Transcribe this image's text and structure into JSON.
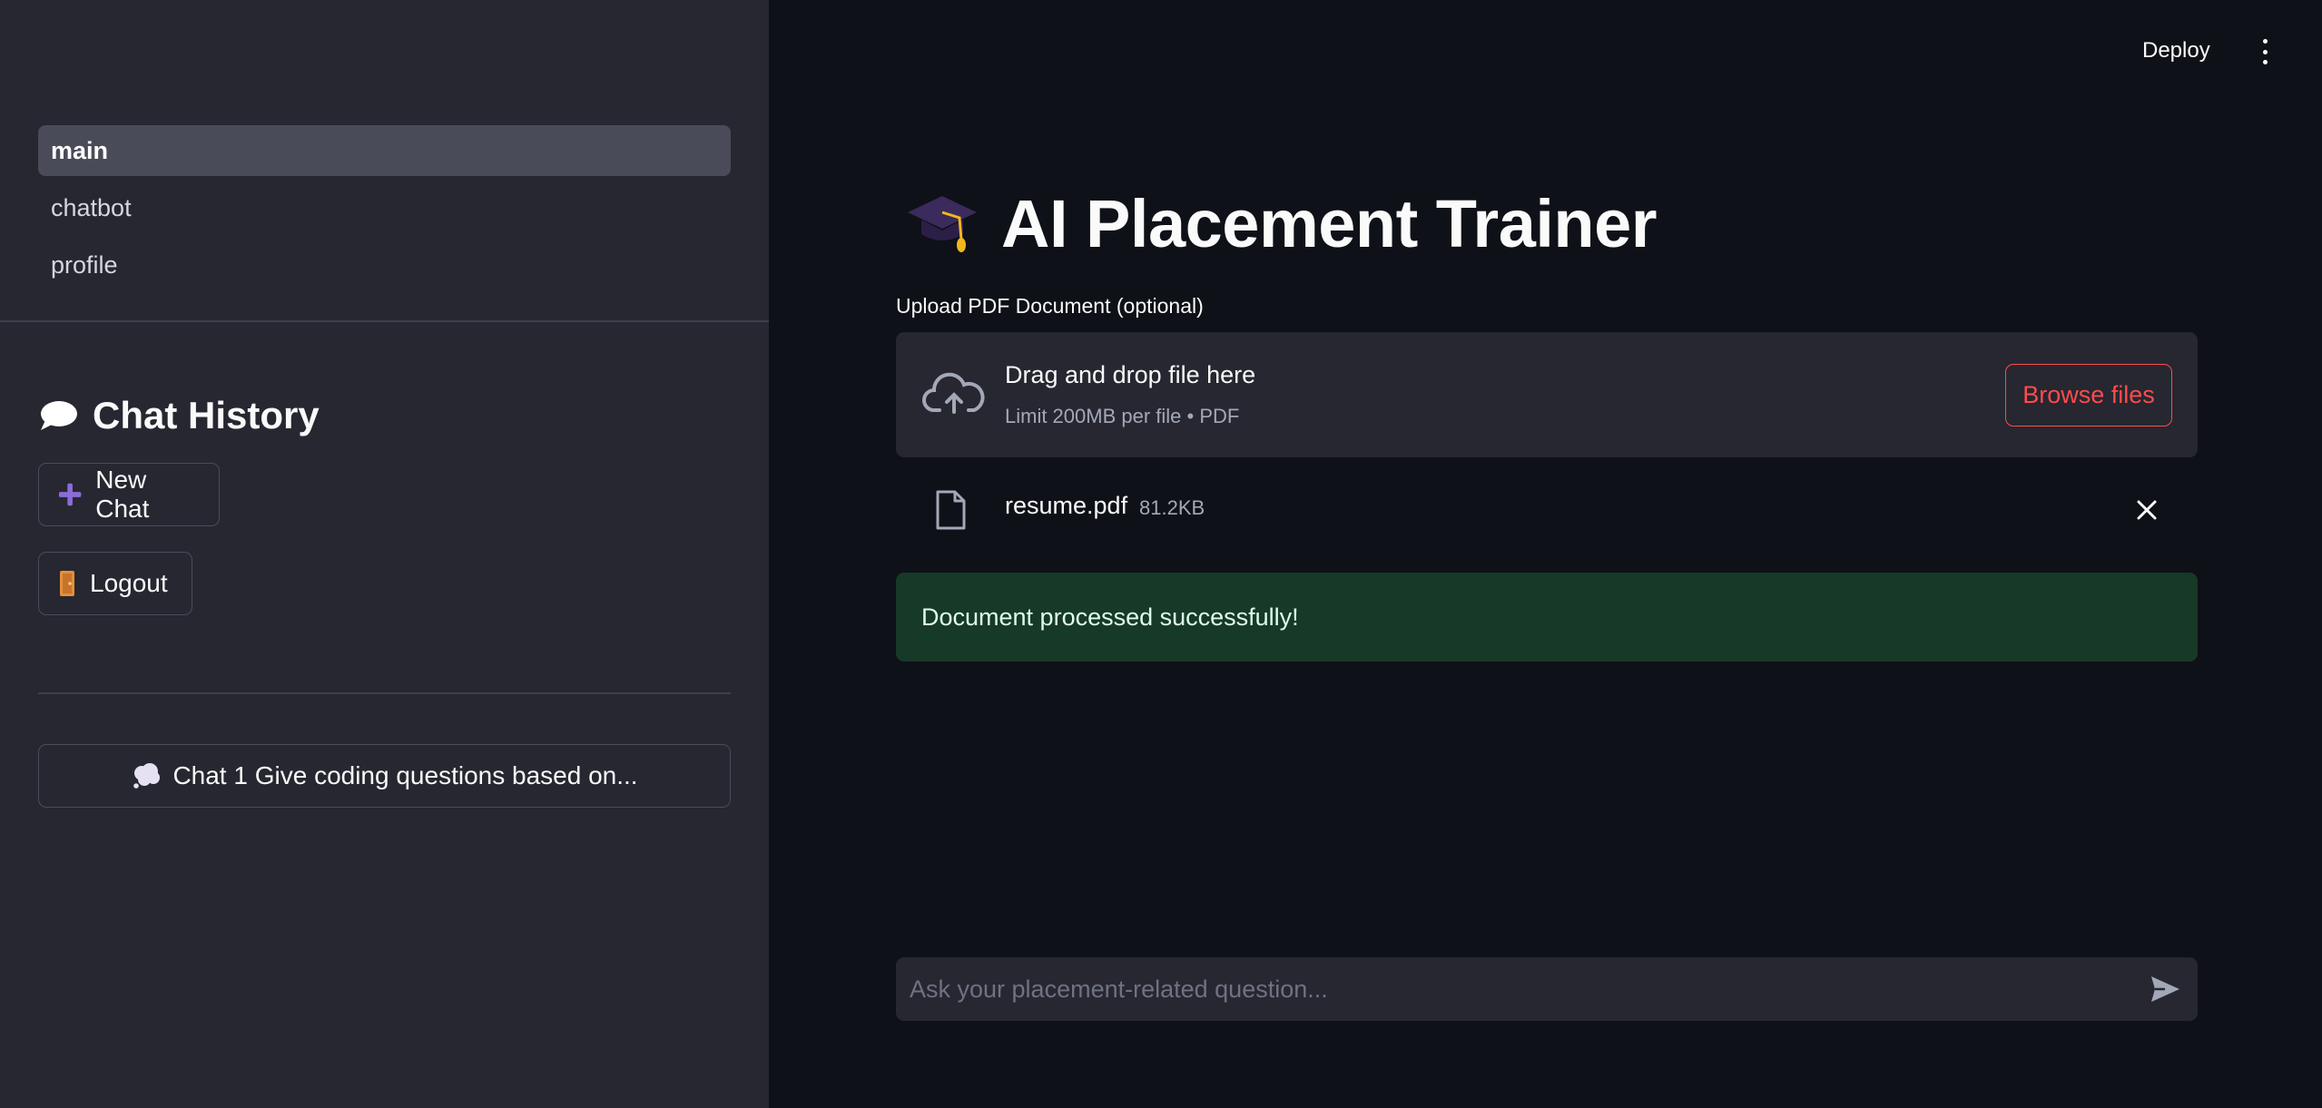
{
  "header": {
    "deploy_label": "Deploy",
    "menu_icon": "kebab-menu-icon"
  },
  "sidebar": {
    "nav_items": [
      {
        "label": "main",
        "active": true
      },
      {
        "label": "chatbot",
        "active": false
      },
      {
        "label": "profile",
        "active": false
      }
    ],
    "history_title": "Chat History",
    "history_icon": "speech-bubble-icon",
    "new_chat_label": "New Chat",
    "new_chat_icon": "plus-icon",
    "logout_label": "Logout",
    "logout_icon": "door-icon",
    "chats": [
      {
        "label": "Chat 1 Give coding questions based on...",
        "icon": "thought-bubble-icon"
      }
    ]
  },
  "main": {
    "title": "AI Placement Trainer",
    "title_icon": "graduation-cap-icon",
    "upload": {
      "label": "Upload PDF Document (optional)",
      "drop_title": "Drag and drop file here",
      "drop_subtitle": "Limit 200MB per file • PDF",
      "browse_label": "Browse files",
      "file_name": "resume.pdf",
      "file_size": "81.2KB"
    },
    "success_message": "Document processed successfully!",
    "chat_input": {
      "placeholder": "Ask your placement-related question...",
      "value": ""
    }
  },
  "colors": {
    "main_bg": "#0e1117",
    "sidebar_bg": "#262730",
    "accent": "#ff4b4b",
    "success_bg": "#173928",
    "plus_icon": "#8b6cd9"
  }
}
